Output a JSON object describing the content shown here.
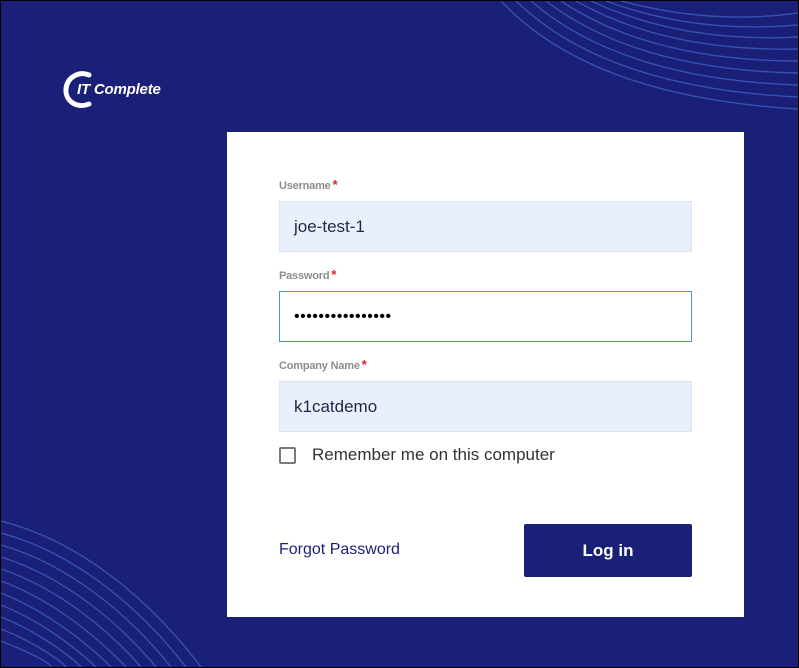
{
  "brand": {
    "logo_text": "IT Complete",
    "logo_icon": "c-swoosh-logo",
    "background_color": "#1a1f78",
    "accent_color": "#1a1f78"
  },
  "form": {
    "username": {
      "label": "Username",
      "required_mark": "*",
      "value": "joe-test-1"
    },
    "password": {
      "label": "Password",
      "required_mark": "*",
      "masked_value": "••••••••••••••••"
    },
    "company": {
      "label": "Company Name",
      "required_mark": "*",
      "value": "k1catdemo"
    },
    "remember_label": "Remember me on this computer",
    "remember_checked": false,
    "forgot_label": "Forgot Password",
    "login_label": "Log in"
  }
}
